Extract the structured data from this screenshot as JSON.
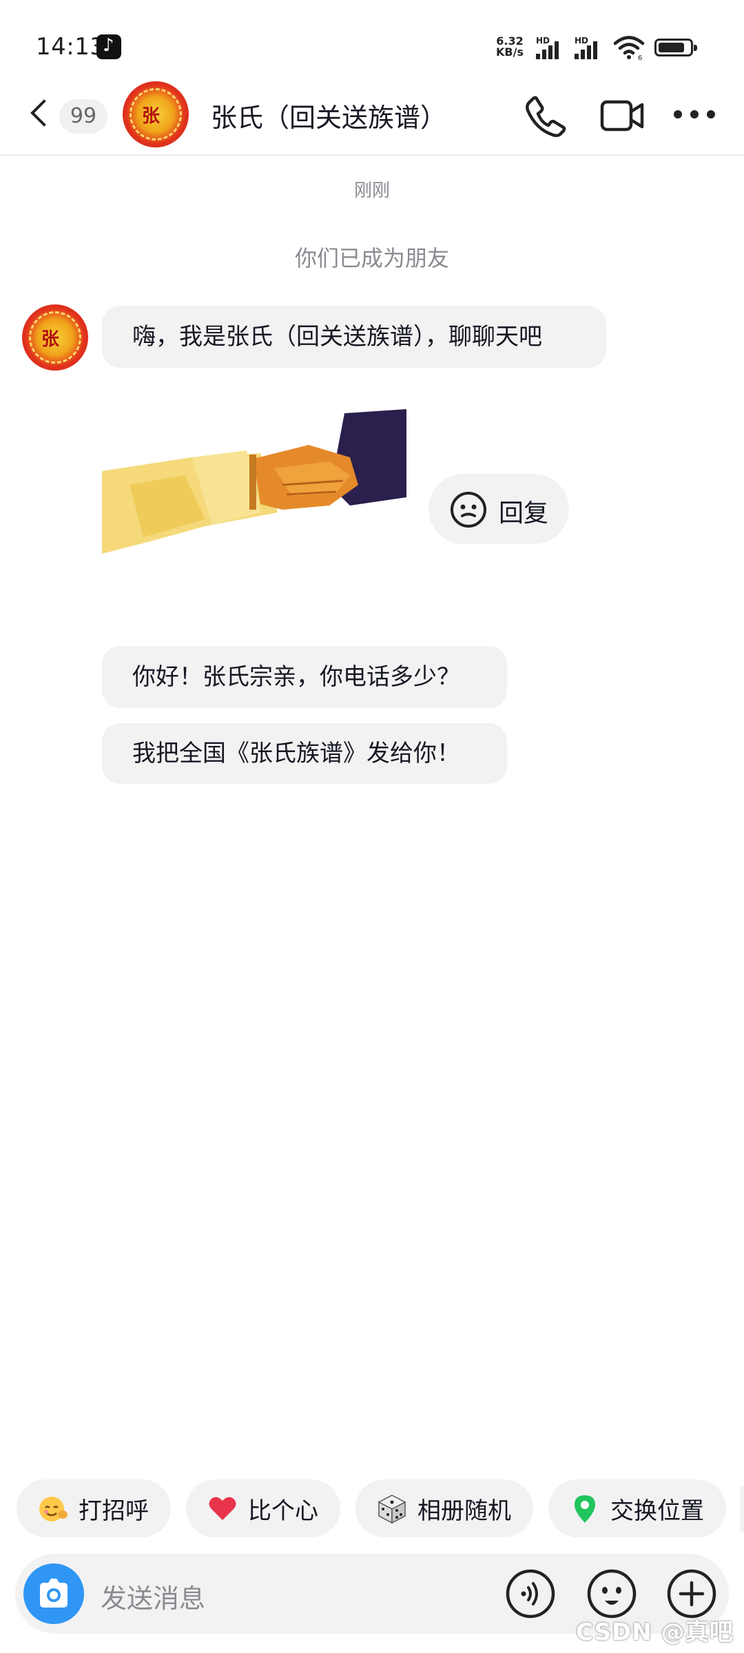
{
  "status_bar": {
    "time": "14:13",
    "app_icon": "tiktok-icon",
    "net_speed_value": "6.32",
    "net_speed_unit": "KB/s",
    "sim1_label": "HD",
    "sim2_label": "HD",
    "wifi_sub": "6",
    "battery_level": 0.85
  },
  "header": {
    "back_icon": "chevron-left-icon",
    "unread_count": "99",
    "avatar_seal_text": "张",
    "title": "张氏（回关送族谱）",
    "phone_icon": "phone-icon",
    "video_icon": "video-camera-icon",
    "more_icon": "more-dots-icon"
  },
  "conversation": {
    "timestamp": "刚刚",
    "system_note": "你们已成为朋友",
    "messages": [
      {
        "type": "text",
        "text": "嗨，我是张氏（回关送族谱），聊聊天吧"
      },
      {
        "type": "sticker",
        "sticker": "handshake-sticker"
      },
      {
        "type": "text",
        "text": "你好！张氏宗亲，你电话多少？"
      },
      {
        "type": "text",
        "text": "我把全国《张氏族谱》发给你！"
      }
    ],
    "reply_button": {
      "label": "回复",
      "icon": "smiley-face-icon"
    }
  },
  "quick_actions": [
    {
      "label": "打招呼",
      "icon": "greeting-emoji-icon"
    },
    {
      "label": "比个心",
      "icon": "heart-icon"
    },
    {
      "label": "相册随机",
      "icon": "dice-icon"
    },
    {
      "label": "交换位置",
      "icon": "location-pin-icon"
    }
  ],
  "input_bar": {
    "placeholder": "发送消息",
    "camera_icon": "camera-icon",
    "voice_icon": "voice-icon",
    "emoji_icon": "emoji-icon",
    "plus_icon": "plus-icon"
  },
  "watermark": "CSDN @真吧",
  "colors": {
    "accent_blue": "#2f96f5",
    "bubble_bg": "#f2f2f2",
    "heart_red": "#e8344a",
    "pin_green": "#22c55e"
  }
}
